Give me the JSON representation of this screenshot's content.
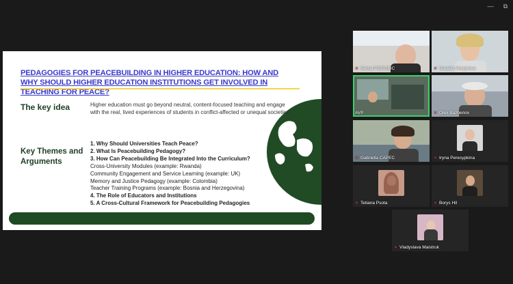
{
  "window": {
    "controls": [
      "—",
      "⧉"
    ]
  },
  "slide": {
    "title": "PEDAGOGIES FOR PEACEBUILDING IN HIGHER EDUCATION: HOW AND WHY SHOULD HIGHER EDUCATION INSTITUTIONS GET INVOLVED IN TEACHING FOR PEACE?",
    "key_idea_label": "The key idea",
    "key_idea_text": "Higher education must go beyond neutral, content-focused teaching and engage with the real, lived experiences of students in conflict-affected or unequal societies",
    "themes_label": "Key Themes and Arguments",
    "themes": [
      "1. Why Should Universities Teach Peace?",
      "2. What Is Peacebuilding Pedagogy?",
      "3. How Can Peacebuilding Be Integrated Into the Curriculum?",
      "Cross-University Modules (example: Rwanda)",
      "Community Engagement and Service Learning (example: UK)",
      "Memory and Justice Pedagogy (example: Colombia)",
      "Teacher Training Programs (example: Bosnia and Herzegovina)",
      "4. The Role of Educators and Institutions",
      "5. A Cross-Cultural Framework for Peacebuilding Pedagogies"
    ],
    "colors": {
      "title": "#3a3acb",
      "accent": "#f4d64a",
      "green": "#1f4a23"
    }
  },
  "participants": [
    {
      "name": "Selma POROBIC",
      "muted": true
    },
    {
      "name": "Nataliia Vinnykova",
      "muted": true
    },
    {
      "name": "AVP",
      "muted": false,
      "active": true
    },
    {
      "name": "Olex Bazhenov",
      "muted": true
    },
    {
      "name": "Gabriella CAPEC",
      "muted": true
    },
    {
      "name": "Iryna Peresypkina",
      "muted": true
    },
    {
      "name": "Tetiana Psota",
      "muted": true
    },
    {
      "name": "Borys Hil",
      "muted": true
    },
    {
      "name": "Vladyslava Maistruk",
      "muted": true
    }
  ]
}
